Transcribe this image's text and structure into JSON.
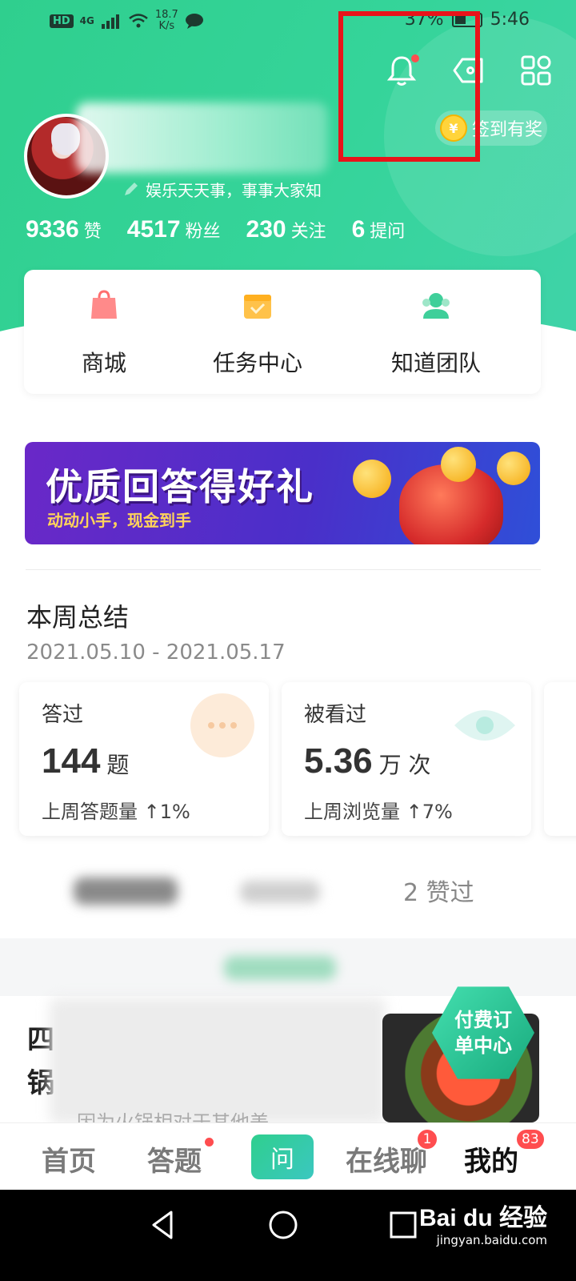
{
  "status_bar": {
    "network": "4G",
    "speed_value": "18.7",
    "speed_unit": "K/s",
    "battery": "37%",
    "time": "5:46"
  },
  "profile": {
    "motto": "娱乐天天事，事事大家知",
    "signin_label": "签到有奖",
    "coin_symbol": "¥",
    "stats": [
      {
        "value": "9336",
        "label": "赞"
      },
      {
        "value": "4517",
        "label": "粉丝"
      },
      {
        "value": "230",
        "label": "关注"
      },
      {
        "value": "6",
        "label": "提问"
      }
    ]
  },
  "shortcuts": [
    {
      "label": "商城",
      "icon": "shopping-bag-icon",
      "color": "#ff8a8a"
    },
    {
      "label": "任务中心",
      "icon": "calendar-task-icon",
      "color": "#ffc24a"
    },
    {
      "label": "知道团队",
      "icon": "team-icon",
      "color": "#3fcf9a"
    }
  ],
  "banner": {
    "title": "优质回答得好礼",
    "subtitle": "动动小手，现金到手"
  },
  "week_summary": {
    "title": "本周总结",
    "date_range": "2021.05.10 - 2021.05.17",
    "cards": [
      {
        "label": "答过",
        "value": "144",
        "unit": "题",
        "foot": "上周答题量 ↑1%"
      },
      {
        "label": "被看过",
        "value": "5.36",
        "unit": "万 次",
        "foot": "上周浏览量 ↑7%"
      }
    ]
  },
  "tabs": {
    "liked": "2 赞过"
  },
  "feed": {
    "title_visible": "四\n锅",
    "snippet": "因为火锅相对于其他美",
    "badge_line1": "付费订",
    "badge_line2": "单中心"
  },
  "bottom_nav": {
    "home": "首页",
    "answer": "答题",
    "ask": "问",
    "chat": "在线聊",
    "chat_badge": "1",
    "mine": "我的",
    "mine_badge": "83"
  },
  "watermark": {
    "logo": "Bai du 经验",
    "url": "jingyan.baidu.com"
  },
  "colors": {
    "accent": "#35d49a",
    "highlight": "#e8141a",
    "badge": "#ff4d4f"
  }
}
